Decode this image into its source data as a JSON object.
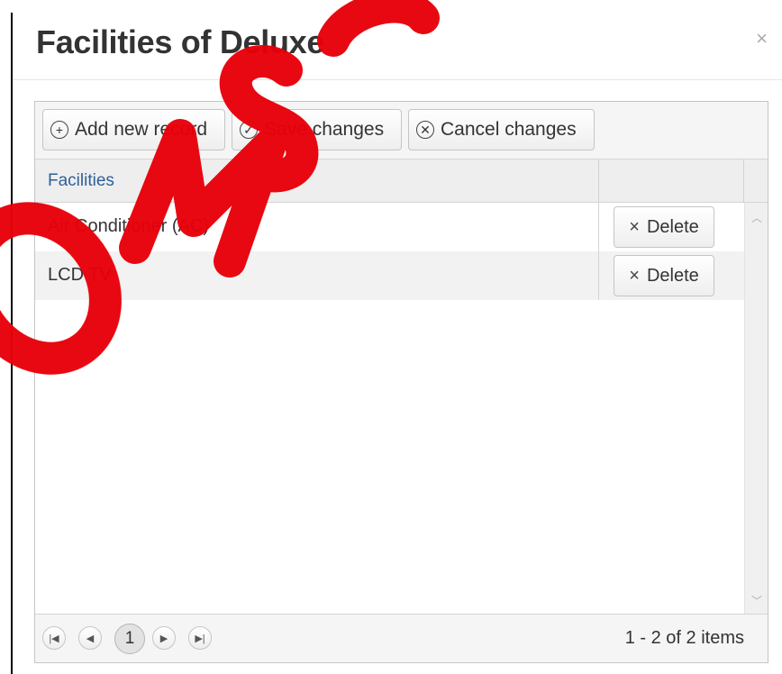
{
  "dialog": {
    "title": "Facilities of Deluxe",
    "close_label": "×"
  },
  "toolbar": {
    "add_label": "Add new record",
    "save_label": "Save changes",
    "cancel_label": "Cancel changes"
  },
  "grid": {
    "columns": [
      "Facilities",
      ""
    ],
    "rows": [
      {
        "facility": "Air Conditioner (AC)",
        "delete_label": "Delete"
      },
      {
        "facility": "LCD TV",
        "delete_label": "Delete"
      }
    ]
  },
  "pager": {
    "current_page": "1",
    "info": "1 - 2 of 2 items"
  },
  "watermark": {
    "text": "OMSO"
  },
  "colors": {
    "watermark": "#e8000a",
    "header_link": "#2e5f9a"
  }
}
